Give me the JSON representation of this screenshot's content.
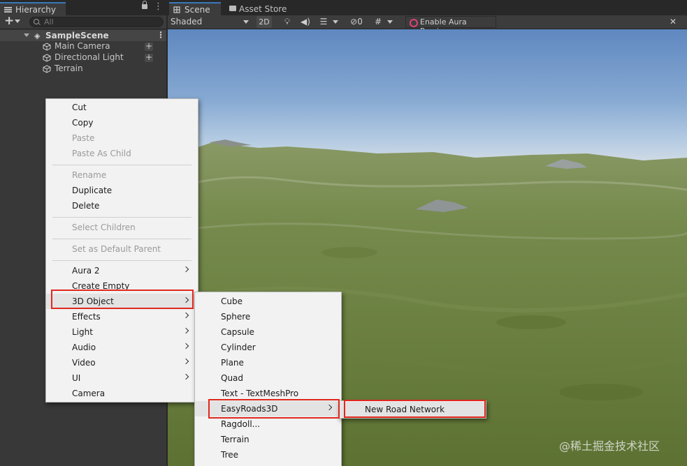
{
  "hierarchy": {
    "tab_title": "Hierarchy",
    "add_icon": "plus-icon",
    "search_placeholder": "All",
    "scene_name": "SampleScene",
    "objects": [
      {
        "label": "Main Camera",
        "add_child": true
      },
      {
        "label": "Directional Light",
        "add_child": true
      },
      {
        "label": "Terrain",
        "add_child": false
      }
    ]
  },
  "scene_view": {
    "tabs": [
      {
        "label": "Scene",
        "icon": "scene-icon",
        "active": true
      },
      {
        "label": "Asset Store",
        "icon": "store-icon",
        "active": false
      }
    ],
    "toolbar": {
      "shading_mode": "Shaded",
      "two_d_label": "2D",
      "hidden_count": "0",
      "aura_label": "Enable Aura Preview"
    }
  },
  "context_menu": {
    "cut": "Cut",
    "copy": "Copy",
    "paste": "Paste",
    "paste_as_child": "Paste As Child",
    "rename": "Rename",
    "duplicate": "Duplicate",
    "delete": "Delete",
    "select_children": "Select Children",
    "set_default_parent": "Set as Default Parent",
    "aura2": "Aura 2",
    "create_empty": "Create Empty",
    "object_3d": "3D Object",
    "effects": "Effects",
    "light": "Light",
    "audio": "Audio",
    "video": "Video",
    "ui": "UI",
    "camera": "Camera"
  },
  "submenu_3d": {
    "cube": "Cube",
    "sphere": "Sphere",
    "capsule": "Capsule",
    "cylinder": "Cylinder",
    "plane": "Plane",
    "quad": "Quad",
    "text_tmp": "Text - TextMeshPro",
    "easyroads": "EasyRoads3D",
    "ragdoll": "Ragdoll...",
    "terrain": "Terrain",
    "tree": "Tree"
  },
  "submenu_easyroads": {
    "new_road_network": "New Road Network"
  },
  "highlight_color": "#e0281e",
  "watermark": "@稀土掘金技术社区"
}
